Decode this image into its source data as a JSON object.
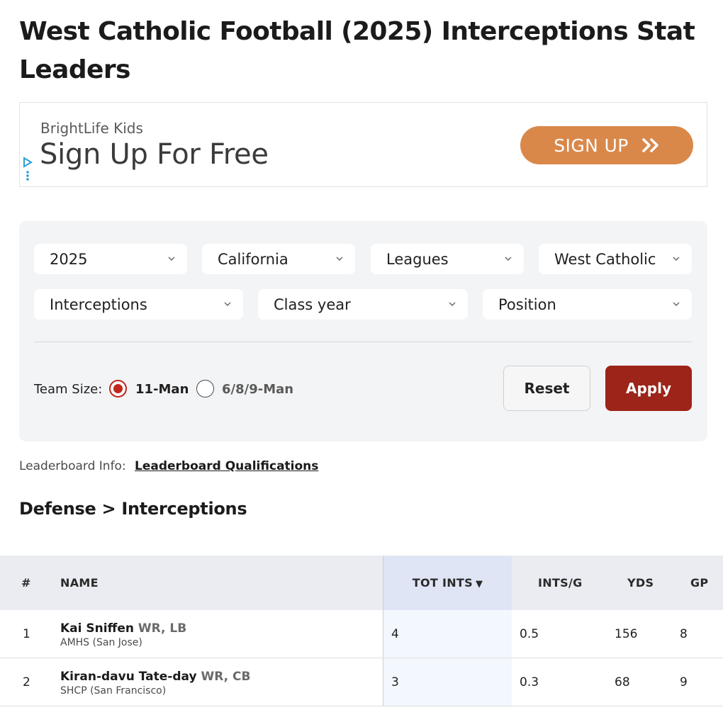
{
  "page": {
    "title": "West Catholic Football (2025) Interceptions Stat Leaders"
  },
  "ad": {
    "brand": "BrightLife Kids",
    "headline": "Sign Up For Free",
    "cta_label": "SIGN UP",
    "cta_color": "#d9884a",
    "choices_icon": "adchoices-icon"
  },
  "filters": {
    "season": "2025",
    "state": "California",
    "league": "Leagues",
    "team": "West Catholic",
    "stat": "Interceptions",
    "class_year": "Class year",
    "position": "Position",
    "team_size_label": "Team Size:",
    "team_size_options": [
      {
        "label": "11-Man",
        "selected": true
      },
      {
        "label": "6/8/9-Man",
        "selected": false
      }
    ],
    "reset_label": "Reset",
    "apply_label": "Apply",
    "accent_color": "#9c2418"
  },
  "leaderboard": {
    "info_label": "Leaderboard Info:",
    "qualifications_link": "Leaderboard Qualifications"
  },
  "section": {
    "title": "Defense > Interceptions"
  },
  "table": {
    "columns": {
      "rank": "#",
      "name": "NAME",
      "tot_ints": "TOT INTS",
      "ints_per_game": "INTS/G",
      "yds": "YDS",
      "gp": "GP"
    },
    "sort_indicator": "▼",
    "rows": [
      {
        "rank": "1",
        "name": "Kai Sniffen",
        "pos": "WR, LB",
        "school": "AMHS (San Jose)",
        "tot_ints": "4",
        "ints_per_game": "0.5",
        "yds": "156",
        "gp": "8"
      },
      {
        "rank": "2",
        "name": "Kiran-davu Tate-day",
        "pos": "WR, CB",
        "school": "SHCP (San Francisco)",
        "tot_ints": "3",
        "ints_per_game": "0.3",
        "yds": "68",
        "gp": "9"
      }
    ]
  }
}
